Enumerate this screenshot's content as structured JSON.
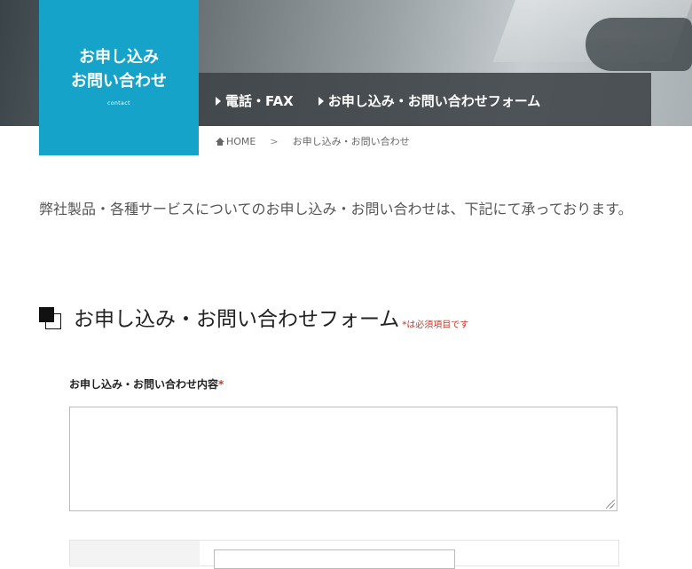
{
  "page_title": {
    "line1": "お申し込み",
    "line2": "お問い合わせ",
    "subtitle": "contact"
  },
  "nav": {
    "items": [
      {
        "label": "電話・FAX"
      },
      {
        "label": "お申し込み・お問い合わせフォーム"
      }
    ]
  },
  "breadcrumb": {
    "home": "HOME",
    "separator": ">",
    "current": "お申し込み・お問い合わせ"
  },
  "intro_text": "弊社製品・各種サービスについてのお申し込み・お問い合わせは、下記にて承っております。",
  "form": {
    "heading": "お申し込み・お問い合わせフォーム",
    "required_note": "*は必須項目です",
    "inquiry_label": "お申し込み・お問い合わせ内容",
    "required_mark": "*",
    "inquiry_value": ""
  },
  "colors": {
    "accent": "#15a3c9",
    "required": "#c0392b"
  }
}
